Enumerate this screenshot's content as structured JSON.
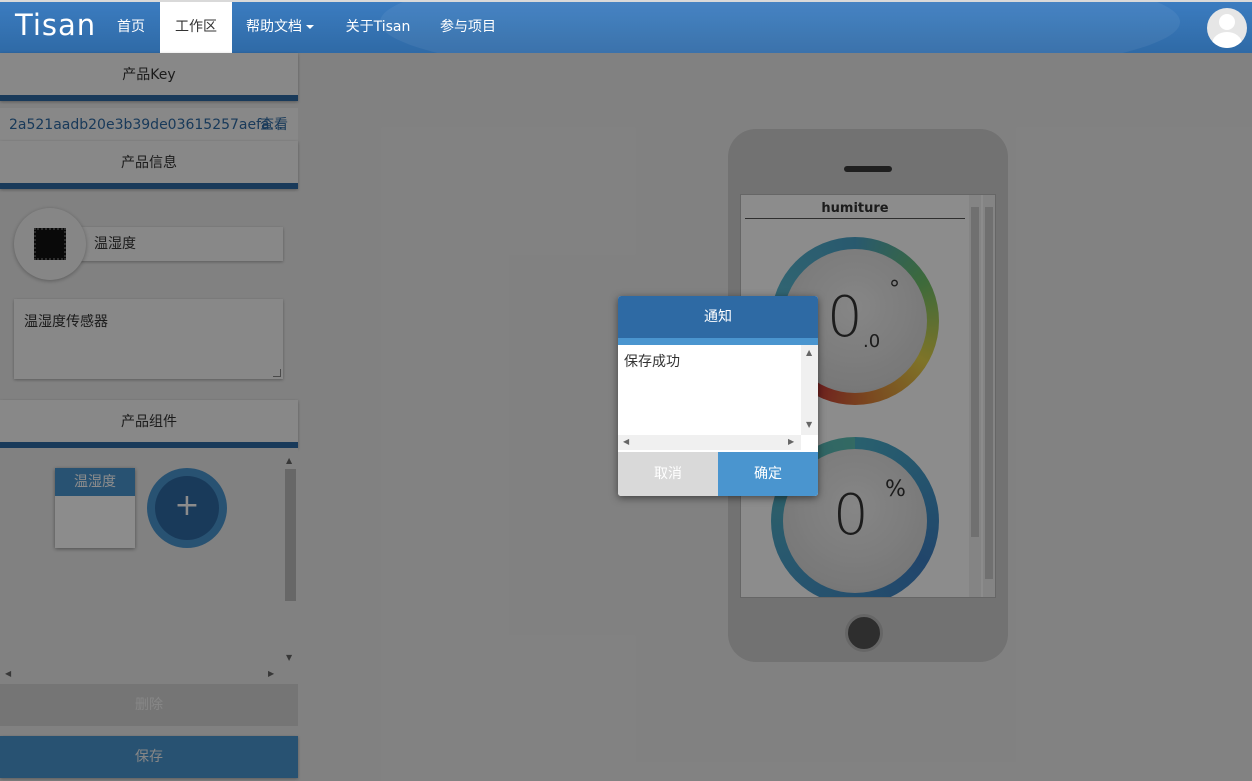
{
  "navbar": {
    "logo": "Tisan",
    "items": [
      {
        "label": "首页"
      },
      {
        "label": "工作区"
      },
      {
        "label": "帮助文档"
      },
      {
        "label": "关于Tisan"
      },
      {
        "label": "参与项目"
      }
    ],
    "active_item": "工作区"
  },
  "sidebar": {
    "product_key_header": "产品Key",
    "product_key_value": "2a521aadb20e3b39de03615257aefa...",
    "product_key_view": "查看",
    "product_info_header": "产品信息",
    "product_name": "温湿度",
    "product_description": "温湿度传感器",
    "product_components_header": "产品组件",
    "components": [
      {
        "label": "温湿度"
      }
    ],
    "add_component_glyph": "+",
    "delete_label": "删除",
    "save_label": "保存"
  },
  "phone_preview": {
    "screen_title": "humiture",
    "gauges": [
      {
        "value": "0",
        "decimal": ".0",
        "unit": "°"
      },
      {
        "value": "0",
        "decimal": "",
        "unit": "%"
      }
    ]
  },
  "dialog": {
    "title": "通知",
    "message": "保存成功",
    "cancel_label": "取消",
    "confirm_label": "确定"
  },
  "colors": {
    "primary": "#2e6aa4",
    "accent": "#4a95cf"
  }
}
